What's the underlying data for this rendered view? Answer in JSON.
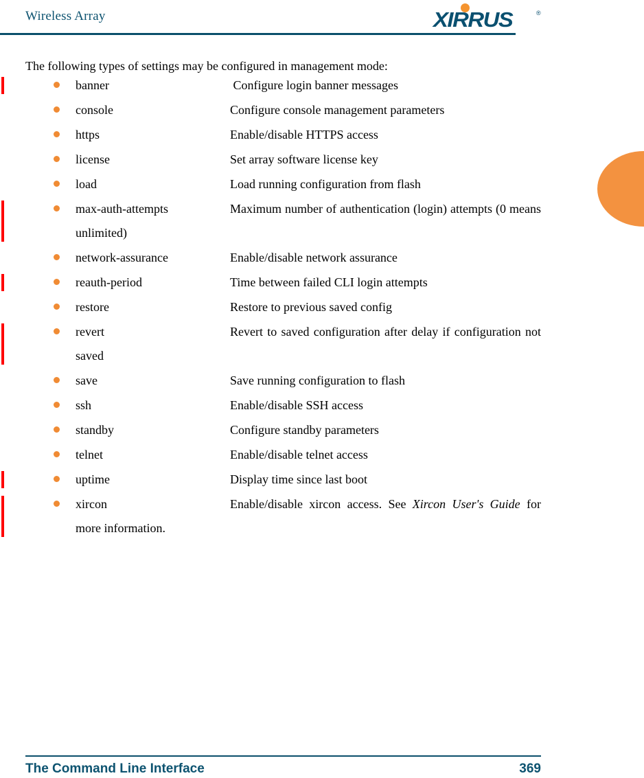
{
  "header": {
    "title": "Wireless Array",
    "logo_text": "XIRRUS",
    "logo_trademark": "®",
    "logo_color": "#0a5070",
    "logo_dot_color": "#f5942f",
    "rule_color": "#0a4f6b"
  },
  "intro": "The following types of settings may be configured in management mode:",
  "accent": {
    "bullet_color": "#f08b34",
    "edge_tab_color": "#f39240",
    "change_bar_color": "#ff0000"
  },
  "settings": [
    {
      "term": "banner",
      "desc": " Configure login banner messages",
      "changed": true
    },
    {
      "term": "console",
      "desc": "Configure console management parameters",
      "changed": false
    },
    {
      "term": "https",
      "desc": "Enable/disable HTTPS access",
      "changed": false
    },
    {
      "term": "license",
      "desc": "Set array software license key",
      "changed": false
    },
    {
      "term": "load",
      "desc": "Load running configuration from flash",
      "changed": false
    },
    {
      "term": "max-auth-attempts",
      "desc": "Maximum number of authentication (login) attempts (0 means unlimited)",
      "changed": true
    },
    {
      "term": "network-assurance",
      "desc": "Enable/disable network assurance",
      "changed": false
    },
    {
      "term": "reauth-period",
      "desc": "Time between failed CLI login attempts",
      "changed": true
    },
    {
      "term": "restore",
      "desc": "Restore to previous saved config",
      "changed": false
    },
    {
      "term": "revert",
      "desc": "Revert to saved configuration after delay if configuration not saved",
      "changed": true
    },
    {
      "term": "save",
      "desc": "Save running configuration to flash",
      "changed": false
    },
    {
      "term": "ssh",
      "desc": "Enable/disable SSH access",
      "changed": false
    },
    {
      "term": "standby",
      "desc": "Configure standby parameters",
      "changed": false
    },
    {
      "term": "telnet",
      "desc": "Enable/disable telnet access",
      "changed": false
    },
    {
      "term": "uptime",
      "desc": "Display time since last boot",
      "changed": true
    },
    {
      "term": "xircon",
      "desc_parts": [
        {
          "text": "Enable/disable xircon access. See ",
          "italic": false
        },
        {
          "text": "Xircon User's Guide",
          "italic": true
        },
        {
          "text": " for more information.",
          "italic": false
        }
      ],
      "changed": true
    }
  ],
  "footer": {
    "section": "The Command Line Interface",
    "page_number": "369"
  }
}
